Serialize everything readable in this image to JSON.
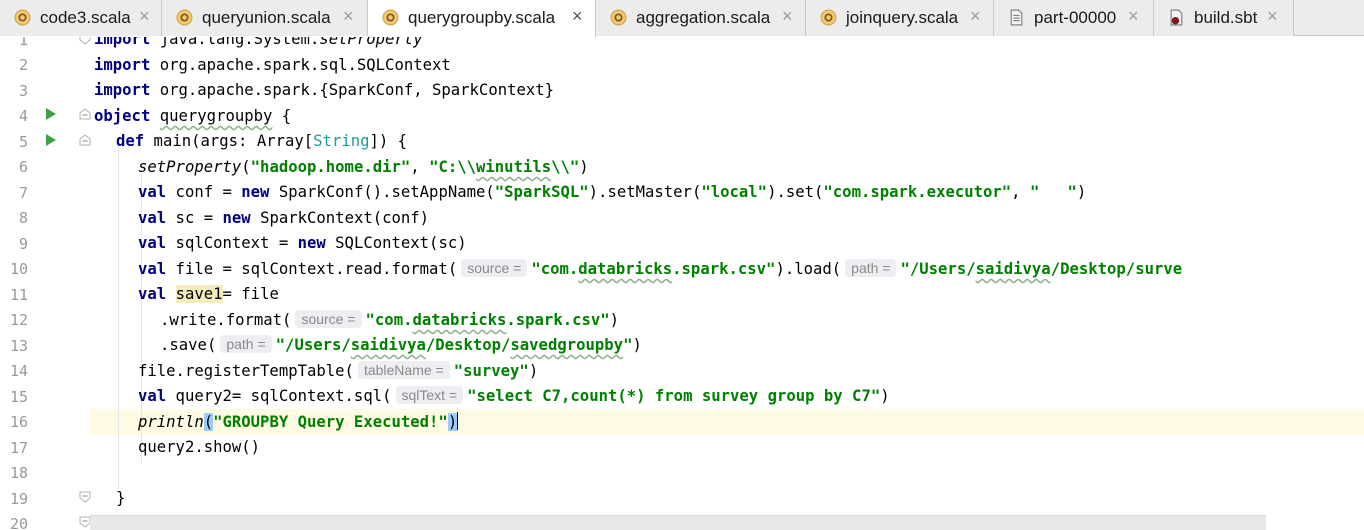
{
  "tabs": [
    {
      "label": "code3.scala",
      "icon": "scala-object-icon"
    },
    {
      "label": "queryunion.scala",
      "icon": "scala-object-icon"
    },
    {
      "label": "querygroupby.scala",
      "icon": "scala-object-icon",
      "active": true
    },
    {
      "label": "aggregation.scala",
      "icon": "scala-object-icon"
    },
    {
      "label": "joinquery.scala",
      "icon": "scala-object-icon"
    },
    {
      "label": "part-00000",
      "icon": "text-file-icon"
    },
    {
      "label": "build.sbt",
      "icon": "sbt-file-icon"
    }
  ],
  "tab_close_glyph": "×",
  "editor": {
    "current_line": 16,
    "line_numbers": [
      "1",
      "2",
      "3",
      "4",
      "5",
      "6",
      "7",
      "8",
      "9",
      "10",
      "11",
      "12",
      "13",
      "14",
      "15",
      "16",
      "17",
      "18",
      "19",
      "20"
    ],
    "lines": {
      "l1": {
        "kw": "import",
        "rest": " java.lang.System.",
        "fn": "setProperty"
      },
      "l2": {
        "kw": "import",
        "rest": " org.apache.spark.sql.SQLContext"
      },
      "l3": {
        "kw": "import",
        "rest": " org.apache.spark.{SparkConf, SparkContext}"
      },
      "l4": {
        "kw": "object",
        "sp": " ",
        "name": "querygroupby",
        "rest": " {"
      },
      "l5": {
        "kw": "def",
        "a": " main(args: Array[",
        "type": "String",
        "b": "]) {"
      },
      "l6": {
        "fn": "setProperty",
        "a": "(",
        "s1": "\"hadoop.home.dir\"",
        "b": ", ",
        "s2a": "\"C:\\\\",
        "s2b": "winutils",
        "s2c": "\\\\\"",
        "c": ")"
      },
      "l7": {
        "kw1": "val",
        "a": " conf = ",
        "kw2": "new",
        "b": " SparkConf().setAppName(",
        "s1": "\"SparkSQL\"",
        "c": ").setMaster(",
        "s2": "\"local\"",
        "d": ").set(",
        "s3": "\"com.spark.executor\"",
        "e": ", ",
        "s4": "\"   \"",
        "f": ")"
      },
      "l8": {
        "kw1": "val",
        "a": " sc = ",
        "kw2": "new",
        "b": " SparkContext(conf)"
      },
      "l9": {
        "kw1": "val",
        "a": " sqlContext = ",
        "kw2": "new",
        "b": " SQLContext(sc)"
      },
      "l10": {
        "kw": "val",
        "a": " file = sqlContext.read.format(",
        "h1": "source =",
        "s1a": "\"com.",
        "s1b": "databricks",
        "s1c": ".spark.csv\"",
        "b": ").load(",
        "h2": "path =",
        "s2a": "\"/Users/",
        "s2b": "saidivya",
        "s2c": "/Desktop/surve"
      },
      "l11": {
        "kw": "val",
        "a": " ",
        "name": "save1",
        "b": "= file"
      },
      "l12": {
        "a": ".write.format(",
        "h1": "source =",
        "s1a": "\"com.",
        "s1b": "databricks",
        "s1c": ".spark.csv\"",
        "b": ")"
      },
      "l13": {
        "a": ".save(",
        "h1": "path =",
        "s1a": "\"/Users/",
        "s1b": "saidivya",
        "s1c": "/Desktop/",
        "s1d": "savedgroupby",
        "s1e": "\"",
        "b": ")"
      },
      "l14": {
        "a": "file.registerTempTable(",
        "h1": "tableName =",
        "s1": "\"survey\"",
        "b": ")"
      },
      "l15": {
        "kw": "val",
        "a": " query2= sqlContext.sql(",
        "h1": "sqlText =",
        "s1": "\"select C7,count(*) from survey group by C7\"",
        "b": ")"
      },
      "l16": {
        "fn": "println",
        "p1": "(",
        "s1": "\"GROUPBY Query Executed!\"",
        "p2": ")"
      },
      "l17": {
        "a": "query2.show()"
      },
      "l18": {
        "a": ""
      },
      "l19": {
        "a": "}"
      },
      "l20": {
        "a": "}"
      }
    }
  },
  "colors": {
    "keyword": "#000080",
    "string": "#008000",
    "type": "#20999d",
    "current_line": "#fffae3",
    "run_icon": "#3aa34a"
  }
}
